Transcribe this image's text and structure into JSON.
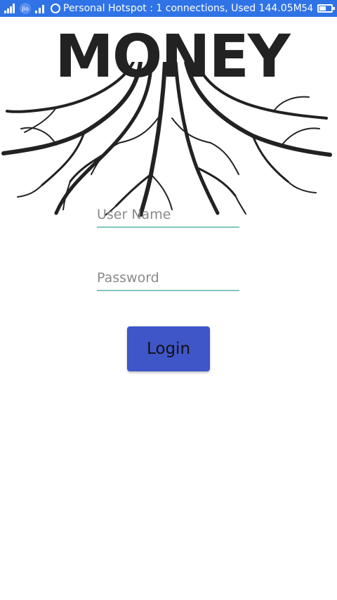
{
  "status_bar": {
    "carrier_badge": "Jio",
    "notification_text": "Personal Hotspot : 1 connections, Used 144.05M",
    "battery_percent_text": "54",
    "battery_level": 0.54,
    "background_color": "#2f73e6"
  },
  "logo": {
    "word": "MONEY"
  },
  "login_form": {
    "username_placeholder": "User Name",
    "username_value": "",
    "password_placeholder": "Password",
    "password_value": "",
    "login_label": "Login",
    "button_color": "#3f56c8",
    "underline_color": "#80c8c0"
  }
}
